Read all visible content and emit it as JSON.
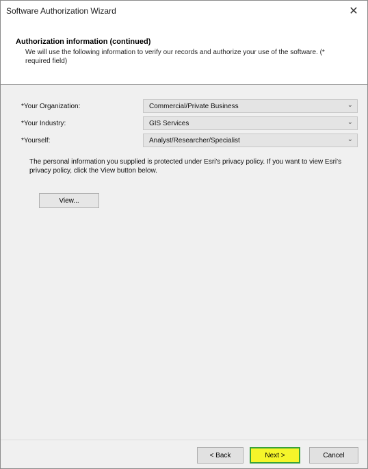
{
  "window": {
    "title": "Software Authorization Wizard",
    "close_glyph": "✕"
  },
  "header": {
    "title": "Authorization information (continued)",
    "description": "We will use the following information to verify our records and authorize your use of the software. (* required field)"
  },
  "form": {
    "organization": {
      "label": "*Your Organization:",
      "value": "Commercial/Private Business"
    },
    "industry": {
      "label": "*Your Industry:",
      "value": "GIS Services"
    },
    "yourself": {
      "label": "*Yourself:",
      "value": "Analyst/Researcher/Specialist"
    },
    "chevron_glyph": "⌄"
  },
  "privacy": {
    "text": "The personal information you supplied is protected under Esri's privacy policy. If you want to view Esri's privacy policy, click the View button below.",
    "view_label": "View..."
  },
  "footer": {
    "back_label": "< Back",
    "next_label": "Next >",
    "cancel_label": "Cancel"
  },
  "colors": {
    "next_highlight": "#f5f52a",
    "next_border": "#3aa23a"
  }
}
